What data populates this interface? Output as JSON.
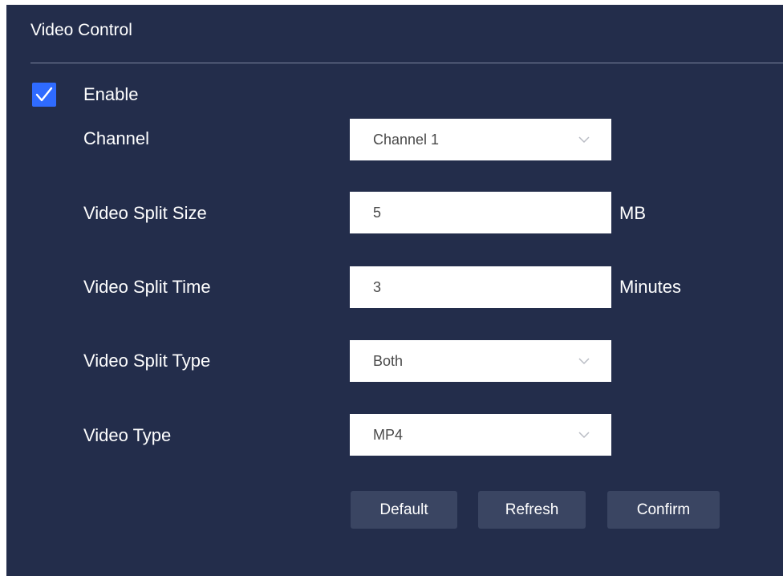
{
  "panel": {
    "title": "Video Control"
  },
  "enable": {
    "label": "Enable",
    "checked": true
  },
  "fields": {
    "channel": {
      "label": "Channel",
      "value": "Channel 1"
    },
    "split_size": {
      "label": "Video Split Size",
      "value": "5",
      "unit": "MB"
    },
    "split_time": {
      "label": "Video Split Time",
      "value": "3",
      "unit": "Minutes"
    },
    "split_type": {
      "label": "Video Split Type",
      "value": "Both"
    },
    "video_type": {
      "label": "Video Type",
      "value": "MP4"
    }
  },
  "buttons": {
    "default": "Default",
    "refresh": "Refresh",
    "confirm": "Confirm"
  },
  "icons": {
    "checkbox": "check-icon",
    "dropdown": "chevron-down-icon"
  },
  "colors": {
    "panel_bg": "#232d4b",
    "accent": "#2f6bff",
    "button_bg": "#3a4562",
    "divider": "#7e86a0"
  }
}
